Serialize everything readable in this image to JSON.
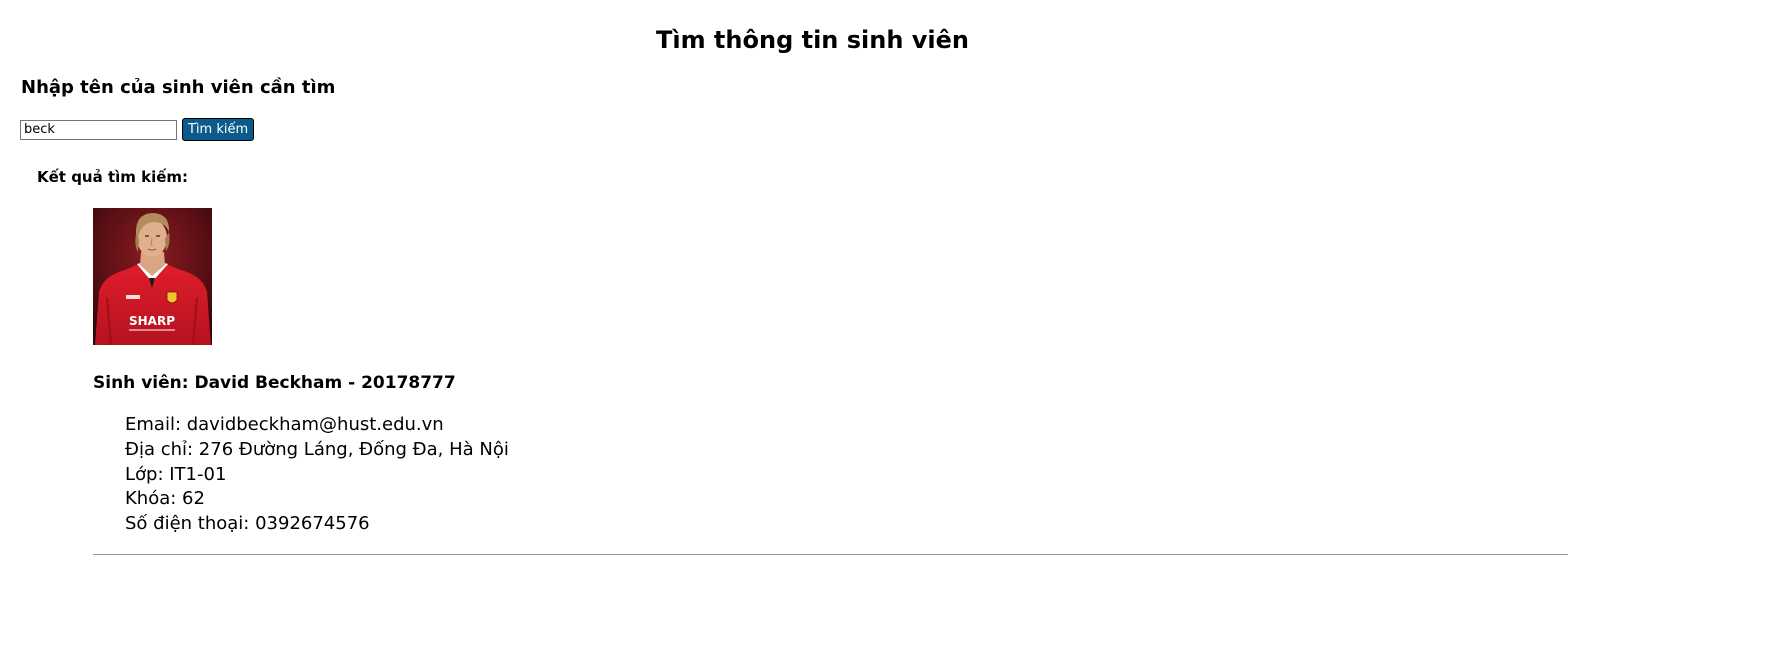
{
  "page": {
    "title": "Tìm thông tin sinh viên"
  },
  "search": {
    "heading": "Nhập tên của sinh viên cần tìm",
    "value": "beck",
    "button_label": "Tìm kiếm"
  },
  "results": {
    "label": "Kết quả tìm kiếm:",
    "items": [
      {
        "heading": "Sinh viên: David Beckham - 20178777",
        "photo_caption": "SHARP",
        "email": "Email: davidbeckham@hust.edu.vn",
        "address": "Địa chỉ: 276 Đường Láng, Đống Đa, Hà Nội",
        "class": "Lớp: IT1-01",
        "cohort": "Khóa: 62",
        "phone": "Số điện thoại: 0392674576"
      }
    ]
  },
  "colors": {
    "button_bg": "#0a5a8c",
    "button_text": "#ffffff",
    "divider": "#9a9a9a",
    "jersey_red": "#c8102e"
  }
}
